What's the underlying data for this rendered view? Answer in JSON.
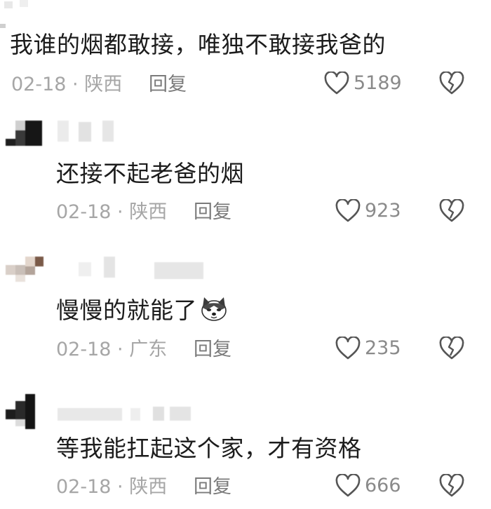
{
  "comments": [
    {
      "text": "我谁的烟都敢接，唯独不敢接我爸的",
      "date": "02-18",
      "location": "陕西",
      "reply_label": "回复",
      "likes": "5189"
    },
    {
      "text": "还接不起老爸的烟",
      "date": "02-18",
      "location": "陕西",
      "reply_label": "回复",
      "likes": "923"
    },
    {
      "text": "慢慢的就能了",
      "date": "02-18",
      "location": "广东",
      "reply_label": "回复",
      "likes": "235"
    },
    {
      "text": "等我能扛起这个家，才有资格",
      "date": "02-18",
      "location": "陕西",
      "reply_label": "回复",
      "likes": "666"
    }
  ],
  "separator": " · ",
  "icons": {
    "like": "heart-outline-icon",
    "dislike": "broken-heart-icon",
    "emoji": "husky-dog-emoji"
  },
  "colors": {
    "text": "#1c1c1c",
    "meta": "#a6a6a6",
    "icon": "#555555"
  }
}
